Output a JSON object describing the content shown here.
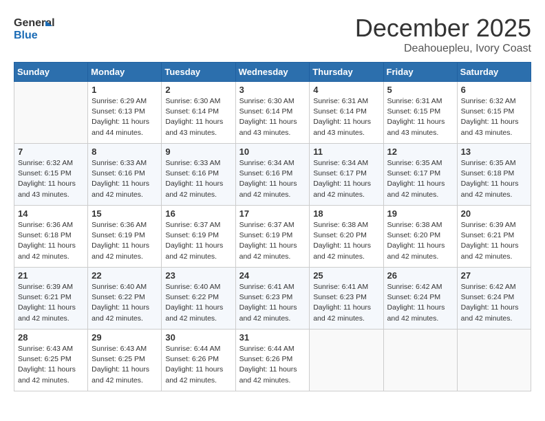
{
  "logo": {
    "line1": "General",
    "line2": "Blue"
  },
  "title": "December 2025",
  "location": "Deahouepleu, Ivory Coast",
  "weekdays": [
    "Sunday",
    "Monday",
    "Tuesday",
    "Wednesday",
    "Thursday",
    "Friday",
    "Saturday"
  ],
  "weeks": [
    [
      {
        "day": "",
        "sunrise": "",
        "sunset": "",
        "daylight": ""
      },
      {
        "day": "1",
        "sunrise": "6:29 AM",
        "sunset": "6:13 PM",
        "daylight": "11 hours and 44 minutes."
      },
      {
        "day": "2",
        "sunrise": "6:30 AM",
        "sunset": "6:14 PM",
        "daylight": "11 hours and 43 minutes."
      },
      {
        "day": "3",
        "sunrise": "6:30 AM",
        "sunset": "6:14 PM",
        "daylight": "11 hours and 43 minutes."
      },
      {
        "day": "4",
        "sunrise": "6:31 AM",
        "sunset": "6:14 PM",
        "daylight": "11 hours and 43 minutes."
      },
      {
        "day": "5",
        "sunrise": "6:31 AM",
        "sunset": "6:15 PM",
        "daylight": "11 hours and 43 minutes."
      },
      {
        "day": "6",
        "sunrise": "6:32 AM",
        "sunset": "6:15 PM",
        "daylight": "11 hours and 43 minutes."
      }
    ],
    [
      {
        "day": "7",
        "sunrise": "6:32 AM",
        "sunset": "6:15 PM",
        "daylight": "11 hours and 43 minutes."
      },
      {
        "day": "8",
        "sunrise": "6:33 AM",
        "sunset": "6:16 PM",
        "daylight": "11 hours and 42 minutes."
      },
      {
        "day": "9",
        "sunrise": "6:33 AM",
        "sunset": "6:16 PM",
        "daylight": "11 hours and 42 minutes."
      },
      {
        "day": "10",
        "sunrise": "6:34 AM",
        "sunset": "6:16 PM",
        "daylight": "11 hours and 42 minutes."
      },
      {
        "day": "11",
        "sunrise": "6:34 AM",
        "sunset": "6:17 PM",
        "daylight": "11 hours and 42 minutes."
      },
      {
        "day": "12",
        "sunrise": "6:35 AM",
        "sunset": "6:17 PM",
        "daylight": "11 hours and 42 minutes."
      },
      {
        "day": "13",
        "sunrise": "6:35 AM",
        "sunset": "6:18 PM",
        "daylight": "11 hours and 42 minutes."
      }
    ],
    [
      {
        "day": "14",
        "sunrise": "6:36 AM",
        "sunset": "6:18 PM",
        "daylight": "11 hours and 42 minutes."
      },
      {
        "day": "15",
        "sunrise": "6:36 AM",
        "sunset": "6:19 PM",
        "daylight": "11 hours and 42 minutes."
      },
      {
        "day": "16",
        "sunrise": "6:37 AM",
        "sunset": "6:19 PM",
        "daylight": "11 hours and 42 minutes."
      },
      {
        "day": "17",
        "sunrise": "6:37 AM",
        "sunset": "6:19 PM",
        "daylight": "11 hours and 42 minutes."
      },
      {
        "day": "18",
        "sunrise": "6:38 AM",
        "sunset": "6:20 PM",
        "daylight": "11 hours and 42 minutes."
      },
      {
        "day": "19",
        "sunrise": "6:38 AM",
        "sunset": "6:20 PM",
        "daylight": "11 hours and 42 minutes."
      },
      {
        "day": "20",
        "sunrise": "6:39 AM",
        "sunset": "6:21 PM",
        "daylight": "11 hours and 42 minutes."
      }
    ],
    [
      {
        "day": "21",
        "sunrise": "6:39 AM",
        "sunset": "6:21 PM",
        "daylight": "11 hours and 42 minutes."
      },
      {
        "day": "22",
        "sunrise": "6:40 AM",
        "sunset": "6:22 PM",
        "daylight": "11 hours and 42 minutes."
      },
      {
        "day": "23",
        "sunrise": "6:40 AM",
        "sunset": "6:22 PM",
        "daylight": "11 hours and 42 minutes."
      },
      {
        "day": "24",
        "sunrise": "6:41 AM",
        "sunset": "6:23 PM",
        "daylight": "11 hours and 42 minutes."
      },
      {
        "day": "25",
        "sunrise": "6:41 AM",
        "sunset": "6:23 PM",
        "daylight": "11 hours and 42 minutes."
      },
      {
        "day": "26",
        "sunrise": "6:42 AM",
        "sunset": "6:24 PM",
        "daylight": "11 hours and 42 minutes."
      },
      {
        "day": "27",
        "sunrise": "6:42 AM",
        "sunset": "6:24 PM",
        "daylight": "11 hours and 42 minutes."
      }
    ],
    [
      {
        "day": "28",
        "sunrise": "6:43 AM",
        "sunset": "6:25 PM",
        "daylight": "11 hours and 42 minutes."
      },
      {
        "day": "29",
        "sunrise": "6:43 AM",
        "sunset": "6:25 PM",
        "daylight": "11 hours and 42 minutes."
      },
      {
        "day": "30",
        "sunrise": "6:44 AM",
        "sunset": "6:26 PM",
        "daylight": "11 hours and 42 minutes."
      },
      {
        "day": "31",
        "sunrise": "6:44 AM",
        "sunset": "6:26 PM",
        "daylight": "11 hours and 42 minutes."
      },
      {
        "day": "",
        "sunrise": "",
        "sunset": "",
        "daylight": ""
      },
      {
        "day": "",
        "sunrise": "",
        "sunset": "",
        "daylight": ""
      },
      {
        "day": "",
        "sunrise": "",
        "sunset": "",
        "daylight": ""
      }
    ]
  ],
  "labels": {
    "sunrise": "Sunrise:",
    "sunset": "Sunset:",
    "daylight": "Daylight: "
  }
}
